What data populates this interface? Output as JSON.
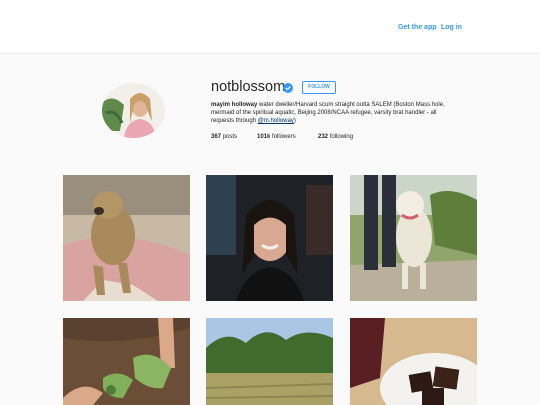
{
  "header": {
    "get_app_label": "Get the app",
    "login_label": "Log in",
    "link_color": "#3897f0"
  },
  "profile": {
    "username": "notblossom",
    "verified": true,
    "follow_label": "FOLLOW",
    "full_name": "mayim holloway",
    "bio_text": "water dweller/Harvard scum straight outta SALEM (Boston Mass.hole, mermaid of the spiritual aquatic, Beijing 2008/NCAA refugee, varsity brat handler - all requests through",
    "bio_mention": "@m.holloway",
    "bio_close": ")",
    "stats": {
      "posts_count": "367",
      "posts_label": "posts",
      "followers_count": "101k",
      "followers_label": "followers",
      "following_count": "232",
      "following_label": "following"
    }
  }
}
